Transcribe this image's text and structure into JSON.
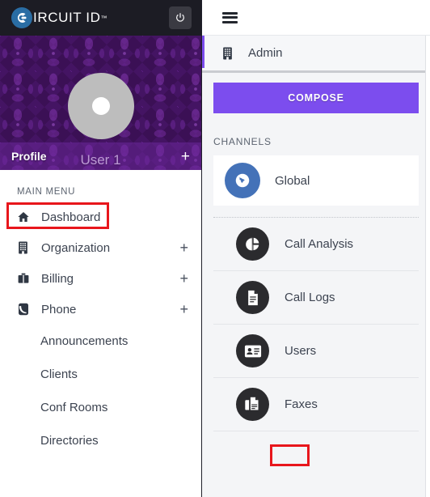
{
  "colors": {
    "brand_bar_bg": "#1c1c24",
    "accent_purple": "#7c4dee",
    "profile_bg": "#3b1055",
    "highlight_red": "#e8161c",
    "global_icon_blue": "#4472b8",
    "list_icon_dark": "#2b2b2e",
    "panel_bg": "#f4f5f7"
  },
  "sidebar": {
    "brand": {
      "name": "IRCUIT ID",
      "trademark": "™",
      "logo_icon": "circuit-c-logo-icon",
      "power_icon": "power-icon"
    },
    "profile": {
      "avatar_icon": "user-avatar-placeholder",
      "user_name": "User 1",
      "label": "Profile",
      "expand_label": "+"
    },
    "menu_header": "MAIN MENU",
    "items": [
      {
        "label": "Dashboard",
        "icon": "home-icon",
        "expandable": false,
        "expand_label": "",
        "highlighted": true
      },
      {
        "label": "Organization",
        "icon": "building-icon",
        "expandable": true,
        "expand_label": "+",
        "highlighted": false
      },
      {
        "label": "Billing",
        "icon": "briefcase-icon",
        "expandable": true,
        "expand_label": "+",
        "highlighted": false
      },
      {
        "label": "Phone",
        "icon": "phone-icon",
        "expandable": true,
        "expand_label": "+",
        "highlighted": false
      }
    ],
    "subitems": [
      {
        "label": "Announcements"
      },
      {
        "label": "Clients"
      },
      {
        "label": "Conf Rooms"
      },
      {
        "label": "Directories"
      }
    ]
  },
  "rightpanel": {
    "topbar": {
      "menu_icon": "hamburger-menu-icon"
    },
    "context": {
      "label": "Admin",
      "icon": "building-icon"
    },
    "compose_label": "COMPOSE",
    "channels_header": "CHANNELS",
    "global_channel": {
      "label": "Global",
      "icon": "globe-icon"
    },
    "list": [
      {
        "label": "Call Analysis",
        "icon": "pie-chart-icon",
        "highlighted": false
      },
      {
        "label": "Call Logs",
        "icon": "document-icon",
        "highlighted": false
      },
      {
        "label": "Users",
        "icon": "id-card-icon",
        "highlighted": false
      },
      {
        "label": "Faxes",
        "icon": "fax-icon",
        "highlighted": true
      }
    ]
  }
}
